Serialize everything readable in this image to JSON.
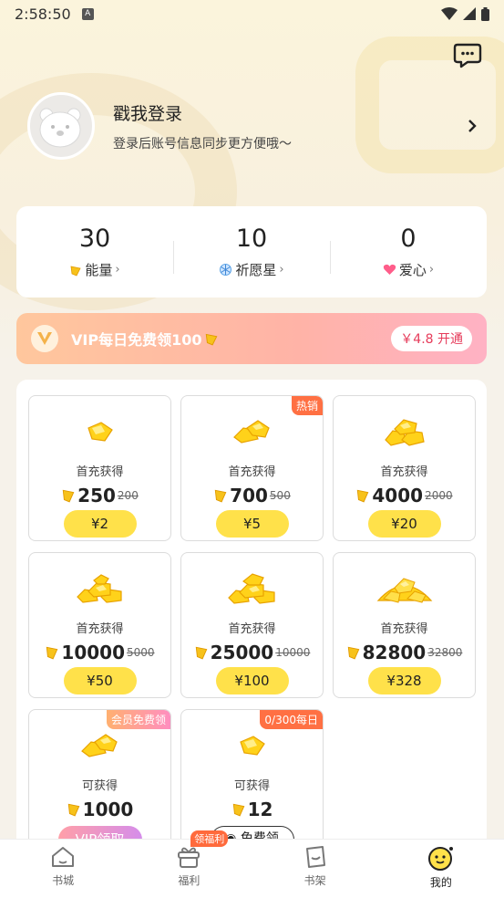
{
  "status_bar": {
    "time": "2:58:50",
    "notif_icon": "A"
  },
  "profile": {
    "title": "戳我登录",
    "subtitle": "登录后账号信息同步更方便哦～"
  },
  "stats": [
    {
      "value": "30",
      "label": "能量",
      "icon": "coin-icon"
    },
    {
      "value": "10",
      "label": "祈愿星",
      "icon": "snowflake-icon"
    },
    {
      "value": "0",
      "label": "爱心",
      "icon": "heart-icon"
    }
  ],
  "vip_banner": {
    "text": "VIP每日免费领100",
    "button": "￥4.8 开通"
  },
  "packs": [
    {
      "label": "首充获得",
      "amount": "250",
      "original": "200",
      "price": "¥2",
      "tag": ""
    },
    {
      "label": "首充获得",
      "amount": "700",
      "original": "500",
      "price": "¥5",
      "tag": "热销"
    },
    {
      "label": "首充获得",
      "amount": "4000",
      "original": "2000",
      "price": "¥20",
      "tag": ""
    },
    {
      "label": "首充获得",
      "amount": "10000",
      "original": "5000",
      "price": "¥50",
      "tag": ""
    },
    {
      "label": "首充获得",
      "amount": "25000",
      "original": "10000",
      "price": "¥100",
      "tag": ""
    },
    {
      "label": "首充获得",
      "amount": "82800",
      "original": "32800",
      "price": "¥328",
      "tag": ""
    },
    {
      "label": "可获得",
      "amount": "1000",
      "original": "",
      "price": "VIP领取",
      "tag": "会员免费领"
    },
    {
      "label": "可获得",
      "amount": "12",
      "original": "",
      "price": "免费领",
      "tag": "0/300每日"
    }
  ],
  "tabbar": {
    "items": [
      {
        "label": "书城",
        "icon": "home-icon"
      },
      {
        "label": "福利",
        "icon": "gift-icon",
        "badge": "领福利"
      },
      {
        "label": "书架",
        "icon": "bookshelf-icon"
      },
      {
        "label": "我的",
        "icon": "profile-face-icon",
        "active": true
      }
    ]
  },
  "colors": {
    "accent_yellow": "#ffe14a",
    "vip_gradient_start": "#ffc79d",
    "vip_gradient_end": "#ffb2c4",
    "hot_tag": "#ff7043"
  }
}
